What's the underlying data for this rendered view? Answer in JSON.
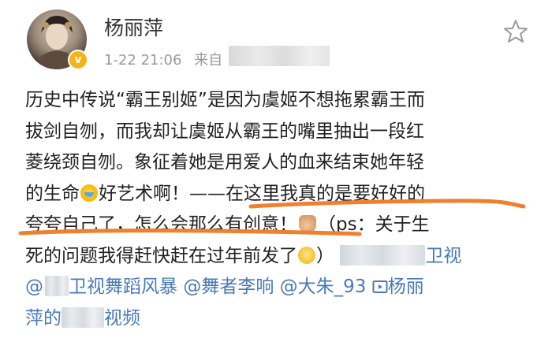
{
  "post": {
    "author_name": "杨丽萍",
    "timestamp": "1-22 21:06",
    "from_label": "来自",
    "verified_badge": "v",
    "line1": "历史中传说“霸王别姬”是因为虞姬不想拖累霸王而",
    "line2": "拔剑自刎，而我却让虞姬从霸王的嘴里抽出一段红",
    "line3": "菱绕颈自刎。象征着她是用爱人的血来结束她年轻",
    "line4_a": "的生命",
    "line4_b": "好艺术啊！——在这里我真的是要好好的",
    "line5_a": "夸夸自己了，怎么会那么有创意！",
    "line5_b": "（ps：关于生",
    "line6_a": "死的问题我得赶快赶在过年前发了",
    "line6_b": "）",
    "line6_c": "卫视",
    "line7_a": "@",
    "line7_b": "卫视舞蹈风暴",
    "line7_mention2": "@舞者李响",
    "line7_mention3": "@大朱_93",
    "line7_c": "杨丽",
    "line7_video_icon": "video-icon",
    "line8_a": "萍的",
    "line8_b": "视频"
  },
  "icons": {
    "star": "star-outline-icon",
    "cry_emoji": "crying-emoji-icon",
    "thumb_emoji": "thumbs-up-emoji-icon",
    "think_emoji": "thinking-emoji-icon"
  },
  "colors": {
    "link": "#4a7ab8",
    "underline_annotation": "#f07f2e",
    "badge": "#f6b21a",
    "meta_text": "#999999"
  }
}
